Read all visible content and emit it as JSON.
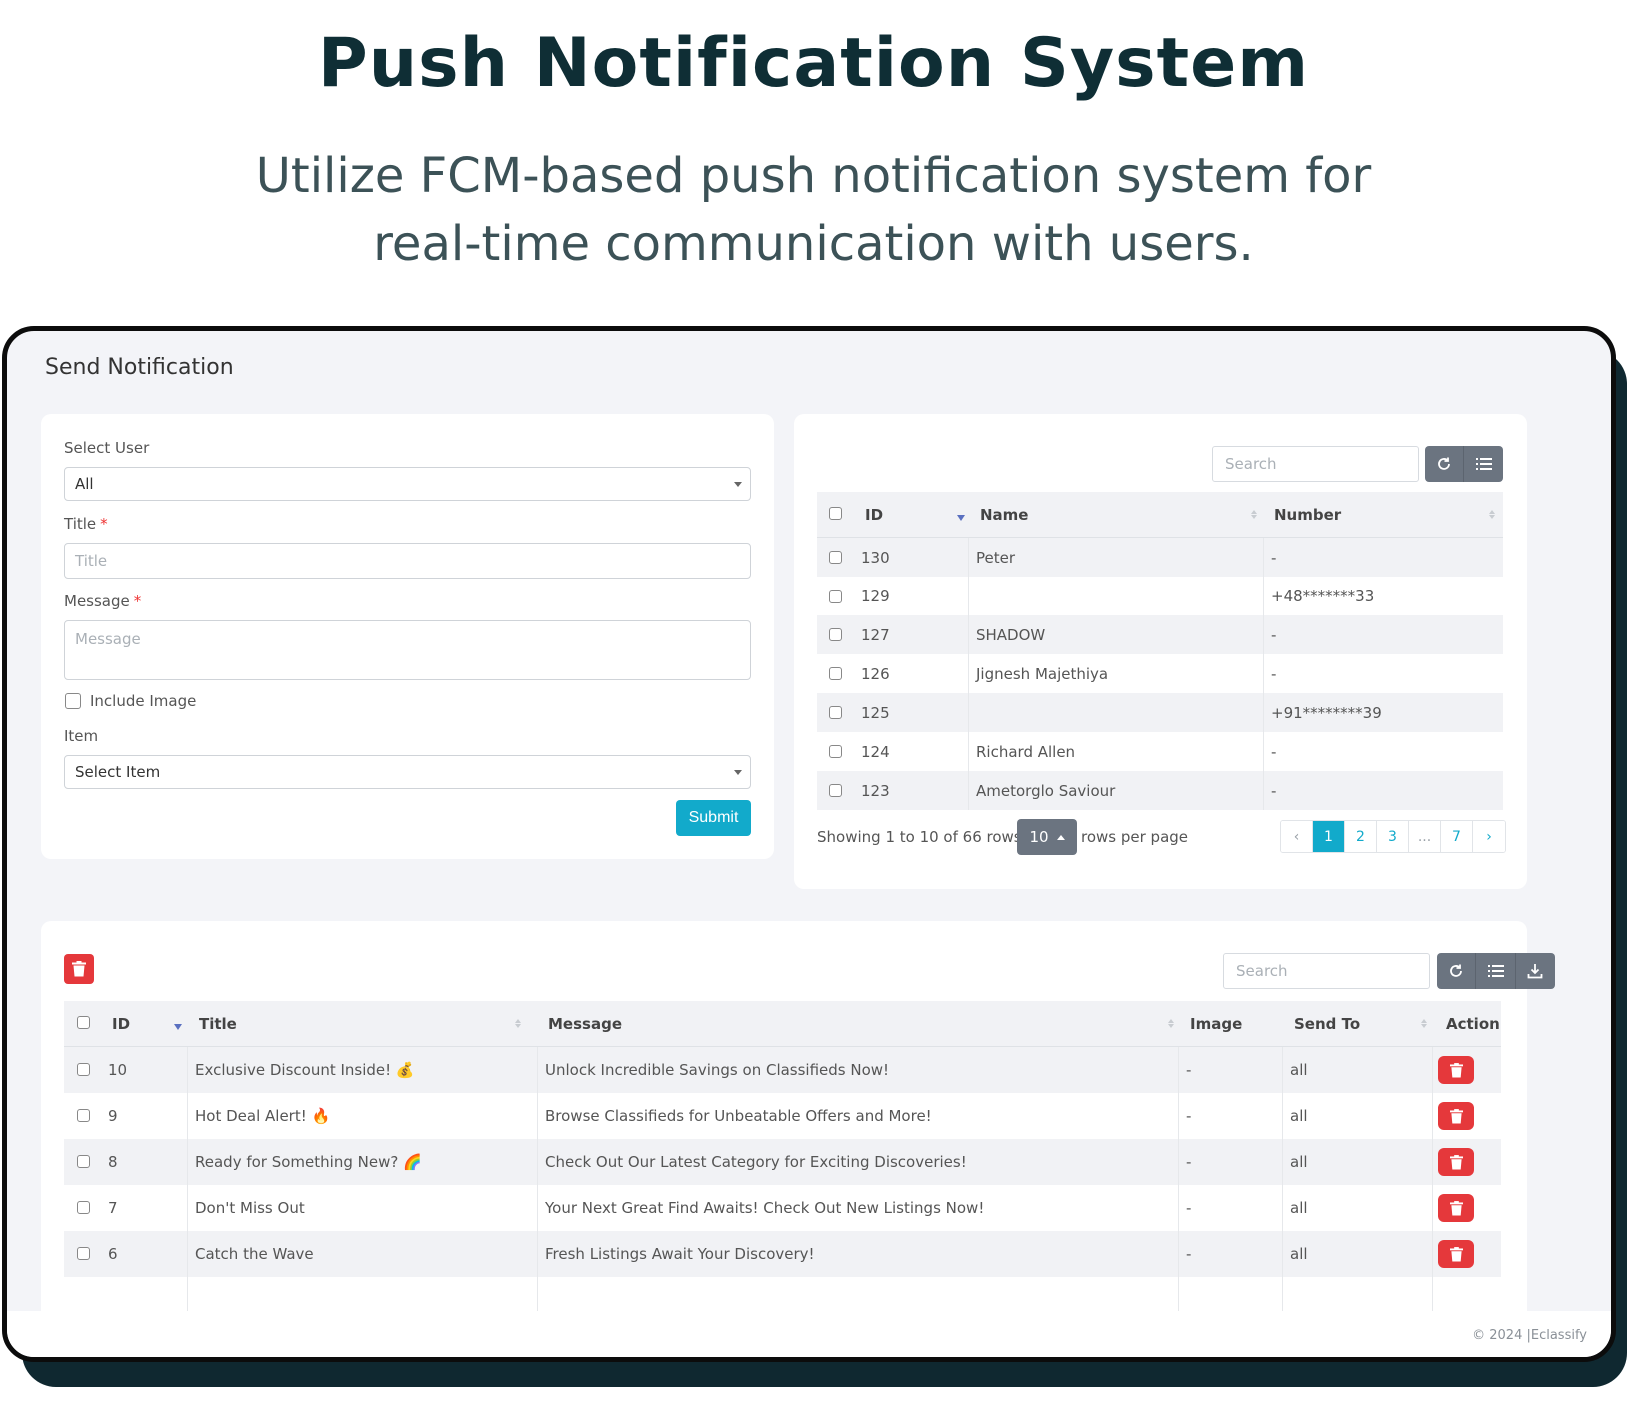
{
  "hero": {
    "title": "Push Notification System",
    "subtitle_line1": "Utilize FCM-based push notification system for",
    "subtitle_line2": "real-time communication with users."
  },
  "page": {
    "heading": "Send Notification"
  },
  "form": {
    "select_user_label": "Select User",
    "select_user_value": "All",
    "title_label": "Title",
    "title_placeholder": "Title",
    "message_label": "Message",
    "message_placeholder": "Message",
    "required_mark": "*",
    "include_image_label": "Include Image",
    "item_label": "Item",
    "item_value": "Select Item",
    "submit_label": "Submit"
  },
  "users_table": {
    "search_placeholder": "Search",
    "columns": [
      "ID",
      "Name",
      "Number"
    ],
    "rows": [
      {
        "id": "130",
        "name": "Peter",
        "number": "-"
      },
      {
        "id": "129",
        "name": "",
        "number": "+48*******33"
      },
      {
        "id": "127",
        "name": "SHADOW",
        "number": "-"
      },
      {
        "id": "126",
        "name": "Jignesh Majethiya",
        "number": "-"
      },
      {
        "id": "125",
        "name": "",
        "number": "+91********39"
      },
      {
        "id": "124",
        "name": "Richard Allen",
        "number": "-"
      },
      {
        "id": "123",
        "name": "Ametorglo Saviour",
        "number": "-"
      }
    ],
    "showing_text": "Showing 1 to 10 of 66 rows",
    "page_size": "10",
    "rows_per_page_text": "rows per page",
    "pages": [
      "‹",
      "1",
      "2",
      "3",
      "...",
      "7",
      "›"
    ]
  },
  "notifications_table": {
    "search_placeholder": "Search",
    "columns": [
      "ID",
      "Title",
      "Message",
      "Image",
      "Send To",
      "Action"
    ],
    "rows": [
      {
        "id": "10",
        "title": "Exclusive Discount Inside! 💰",
        "message": "Unlock Incredible Savings on Classifieds Now!",
        "image": "-",
        "send_to": "all"
      },
      {
        "id": "9",
        "title": "Hot Deal Alert! 🔥",
        "message": "Browse Classifieds for Unbeatable Offers and More!",
        "image": "-",
        "send_to": "all"
      },
      {
        "id": "8",
        "title": "Ready for Something New? 🌈",
        "message": "Check Out Our Latest Category for Exciting Discoveries!",
        "image": "-",
        "send_to": "all"
      },
      {
        "id": "7",
        "title": "Don't Miss Out",
        "message": "Your Next Great Find Awaits! Check Out New Listings Now!",
        "image": "-",
        "send_to": "all"
      },
      {
        "id": "6",
        "title": "Catch the Wave",
        "message": "Fresh Listings Await Your Discovery!",
        "image": "-",
        "send_to": "all"
      }
    ]
  },
  "footer": {
    "text": "© 2024 |Eclassify"
  },
  "colors": {
    "accent": "#12aacb",
    "danger": "#e5383b",
    "toolbar": "#6b7480",
    "heading": "#0f2e35"
  }
}
